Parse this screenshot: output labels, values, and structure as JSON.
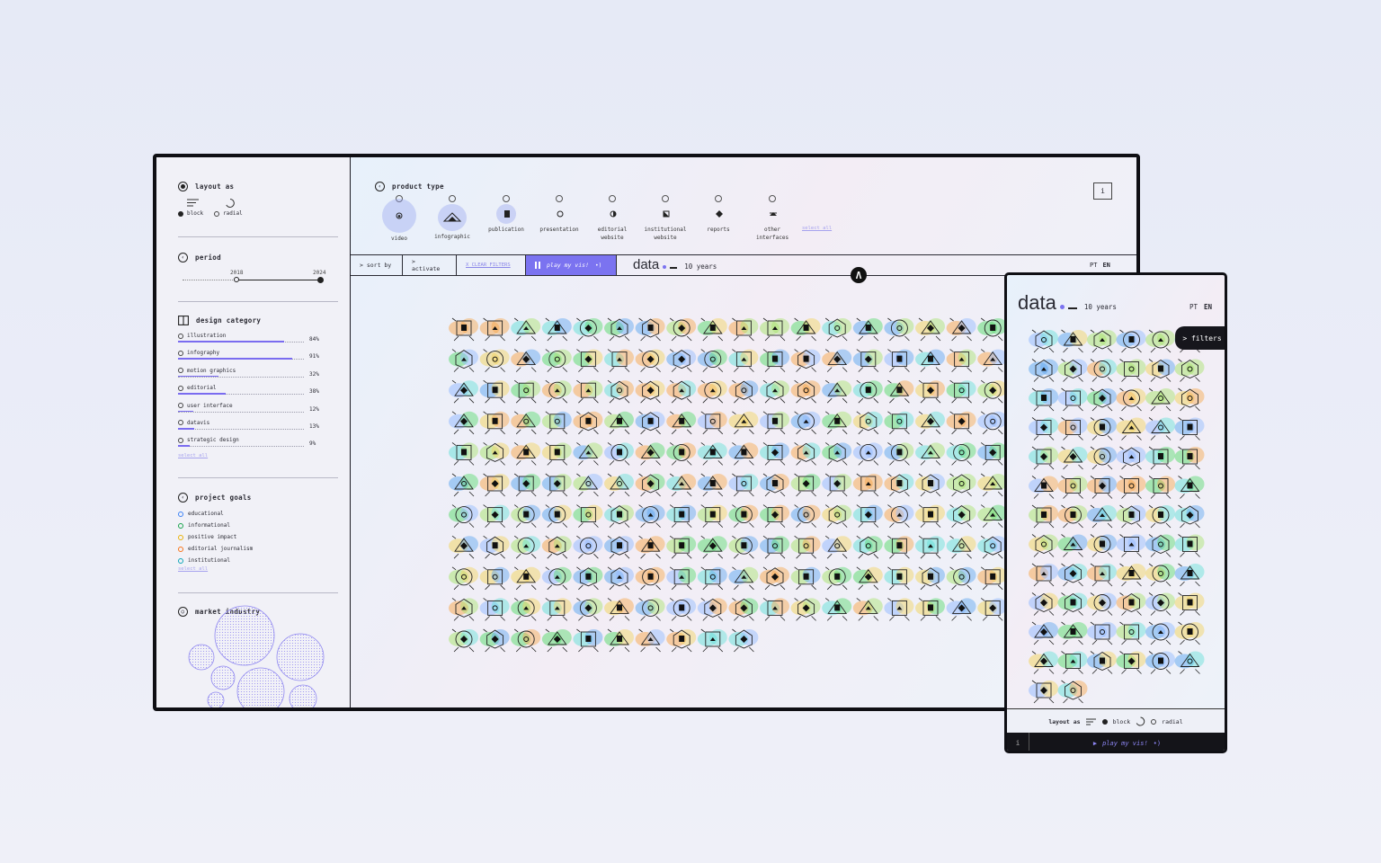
{
  "sidebar": {
    "layout": {
      "title": "layout as",
      "options": [
        "block",
        "radial"
      ],
      "selected": "block"
    },
    "period": {
      "title": "period",
      "start_label": "2018",
      "end_label": "2024"
    },
    "design_category": {
      "title": "design category",
      "items": [
        {
          "label": "illustration",
          "pct_label": "84%",
          "pct": 84
        },
        {
          "label": "infography",
          "pct_label": "91%",
          "pct": 91
        },
        {
          "label": "motion graphics",
          "pct_label": "32%",
          "pct": 32
        },
        {
          "label": "editorial",
          "pct_label": "38%",
          "pct": 38
        },
        {
          "label": "user interface",
          "pct_label": "12%",
          "pct": 12
        },
        {
          "label": "datavis",
          "pct_label": "13%",
          "pct": 13
        },
        {
          "label": "strategic design",
          "pct_label": "9%",
          "pct": 9
        }
      ],
      "select_all": "select all"
    },
    "project_goals": {
      "title": "project goals",
      "items": [
        {
          "label": "educational",
          "color": "#3b82f6"
        },
        {
          "label": "informational",
          "color": "#16a34a"
        },
        {
          "label": "positive impact",
          "color": "#eab308"
        },
        {
          "label": "editorial journalism",
          "color": "#f97316"
        },
        {
          "label": "institutional",
          "color": "#0ea5b7"
        }
      ],
      "select_all": "select all"
    },
    "market_industry": {
      "title": "market industry"
    }
  },
  "product_type": {
    "title": "product type",
    "items": [
      {
        "label": "video",
        "icon": "video-icon",
        "active": true
      },
      {
        "label": "infographic",
        "icon": "infographic-icon",
        "active": true
      },
      {
        "label": "publication",
        "icon": "publication-icon",
        "active": true
      },
      {
        "label": "presentation",
        "icon": "presentation-icon",
        "active": false
      },
      {
        "label": "editorial\nwebsite",
        "icon": "editorial-website-icon",
        "active": false
      },
      {
        "label": "institutional\nwebsite",
        "icon": "institutional-website-icon",
        "active": false
      },
      {
        "label": "reports",
        "icon": "reports-icon",
        "active": false
      },
      {
        "label": "other\ninterfaces",
        "icon": "other-interfaces-icon",
        "active": false
      }
    ],
    "select_all": "select all"
  },
  "toolbar": {
    "sort_by": "> sort by",
    "activate": "> activate",
    "clear_filters": "X CLEAR FILTERS",
    "play": "play my vis!",
    "logo": "data",
    "years": "10 years",
    "lang_pt": "PT",
    "lang_en": "EN",
    "info": "i"
  },
  "mobile": {
    "logo": "data",
    "years": "10 years",
    "lang_pt": "PT",
    "lang_en": "EN",
    "filters": "> filters",
    "layout_label": "layout as",
    "block": "block",
    "radial": "radial",
    "play": "play my vis!",
    "info": "i"
  },
  "colors": {
    "accent": "#7b73f0",
    "dark": "#121218"
  }
}
